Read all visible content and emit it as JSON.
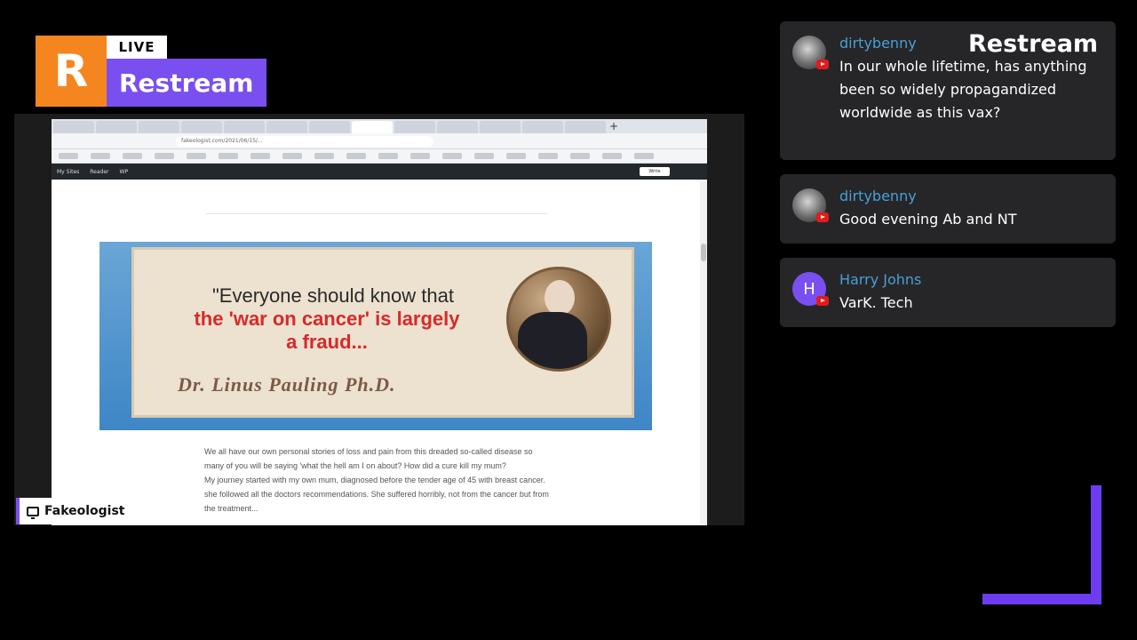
{
  "logo": {
    "initial": "R",
    "live": "LIVE",
    "name": "Restream"
  },
  "browser": {
    "address": "fakeologist.com/2021/06/15/...",
    "wp_admin": {
      "items": [
        "My Sites",
        "Reader",
        "WP"
      ],
      "button": "Write"
    },
    "banner": {
      "quote_line1": "\"Everyone should know that",
      "quote_line2": "the 'war on cancer' is largely",
      "quote_line3": "a fraud...",
      "signature": "Dr. Linus Pauling Ph.D."
    },
    "article": [
      "We all have our own personal stories of loss and pain from this dreaded so-called disease so many of you will be saying 'what the hell am I on about? How did a cure kill my mum?",
      "My journey started with my own mum, diagnosed before the tender age of 45 with breast cancer. she followed all the doctors recommendations. She suffered horribly, not from the cancer but from the treatment..."
    ]
  },
  "source": {
    "label": "Fakeologist",
    "icon": "monitor-icon"
  },
  "chat": {
    "brand": "Restream",
    "messages": [
      {
        "user": "dirtybenny",
        "text": "In our whole lifetime, has anything been so widely propagandized worldwide as this vax?",
        "platform": "youtube"
      },
      {
        "user": "dirtybenny",
        "text": "Good evening Ab and NT",
        "platform": "youtube"
      },
      {
        "user": "Harry Johns",
        "avatar_letter": "H",
        "text": "VarK. Tech",
        "platform": "youtube"
      }
    ]
  },
  "colors": {
    "restream_orange": "#f5861f",
    "restream_purple": "#7a4ff0",
    "chat_bg": "#262628",
    "username": "#4a9fd6"
  }
}
